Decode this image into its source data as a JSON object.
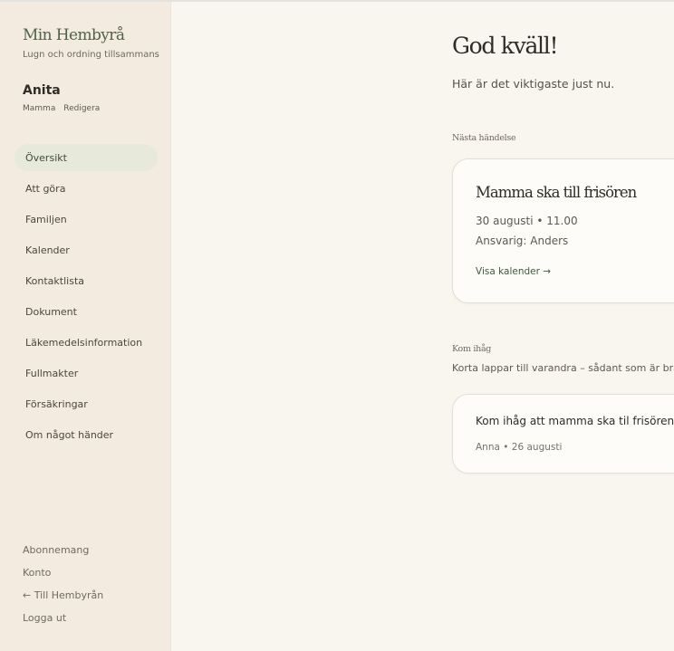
{
  "sidebar": {
    "brand": "Min Hembyrå",
    "tagline": "Lugn och ordning tillsammans",
    "user": {
      "name": "Anita",
      "role": "Mamma",
      "edit_label": "Redigera"
    },
    "nav": [
      {
        "label": "Översikt",
        "active": true
      },
      {
        "label": "Att göra"
      },
      {
        "label": "Familjen"
      },
      {
        "label": "Kalender"
      },
      {
        "label": "Kontaktlista"
      },
      {
        "label": "Dokument"
      },
      {
        "label": "Läkemedelsinformation"
      },
      {
        "label": "Fullmakter"
      },
      {
        "label": "Försäkringar"
      },
      {
        "label": "Om något händer"
      }
    ],
    "footer": [
      "Abonnemang",
      "Konto",
      "← Till Hembyrån",
      "Logga ut"
    ]
  },
  "main": {
    "greeting": "God kväll!",
    "subtitle": "Här är det viktigaste just nu.",
    "next_event": {
      "section_label": "Nästa händelse",
      "title": "Mamma ska till frisören",
      "datetime": "30 augusti • 11.00",
      "responsible": "Ansvarig: Anders",
      "link": "Visa kalender →"
    },
    "reminders": {
      "section_label": "Kom ihåg",
      "description": "Korta lappar till varandra – sådant som är bra att",
      "note": {
        "text": "Kom ihåg att mamma ska til frisören!",
        "meta": "Anna • 26 augusti"
      }
    }
  },
  "colors": {
    "accent": "#3d5a3a",
    "sidebar_bg": "#f3ebdf",
    "page_bg": "#f9f6ef",
    "active_nav": "#e7eadb"
  }
}
